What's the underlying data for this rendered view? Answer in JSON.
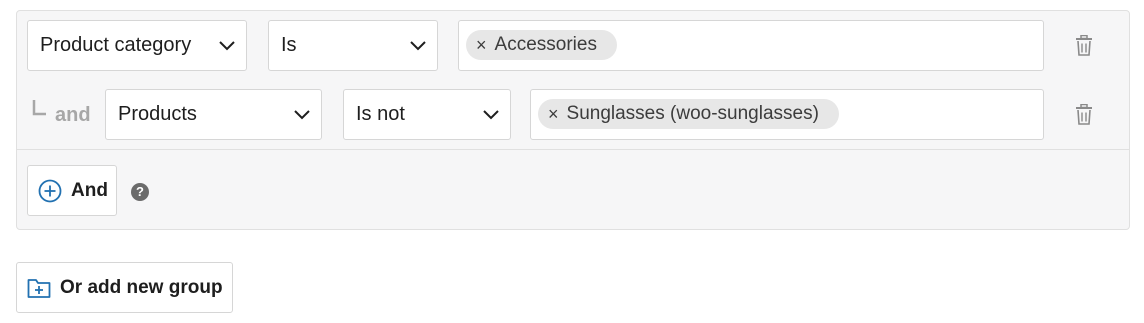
{
  "group": {
    "rows": [
      {
        "field": "Product category",
        "operator": "Is",
        "values": [
          "Accessories"
        ]
      },
      {
        "connector": "and",
        "field": "Products",
        "operator": "Is not",
        "values": [
          "Sunglasses (woo-sunglasses)"
        ]
      }
    ],
    "and_button_label": "And",
    "help_glyph": "?"
  },
  "or_group_button_label": "Or add new group",
  "token_remove_glyph": "×",
  "colors": {
    "accent": "#2271b1",
    "group_background": "#f6f6f7",
    "token_background": "#e7e7e7",
    "connector_text": "#a7a7a7"
  },
  "icons": {
    "dropdown": "chevron-down-icon",
    "delete": "trash-icon",
    "add_condition": "plus-circle-icon",
    "add_group": "folder-plus-icon",
    "help": "question-circle-icon"
  }
}
